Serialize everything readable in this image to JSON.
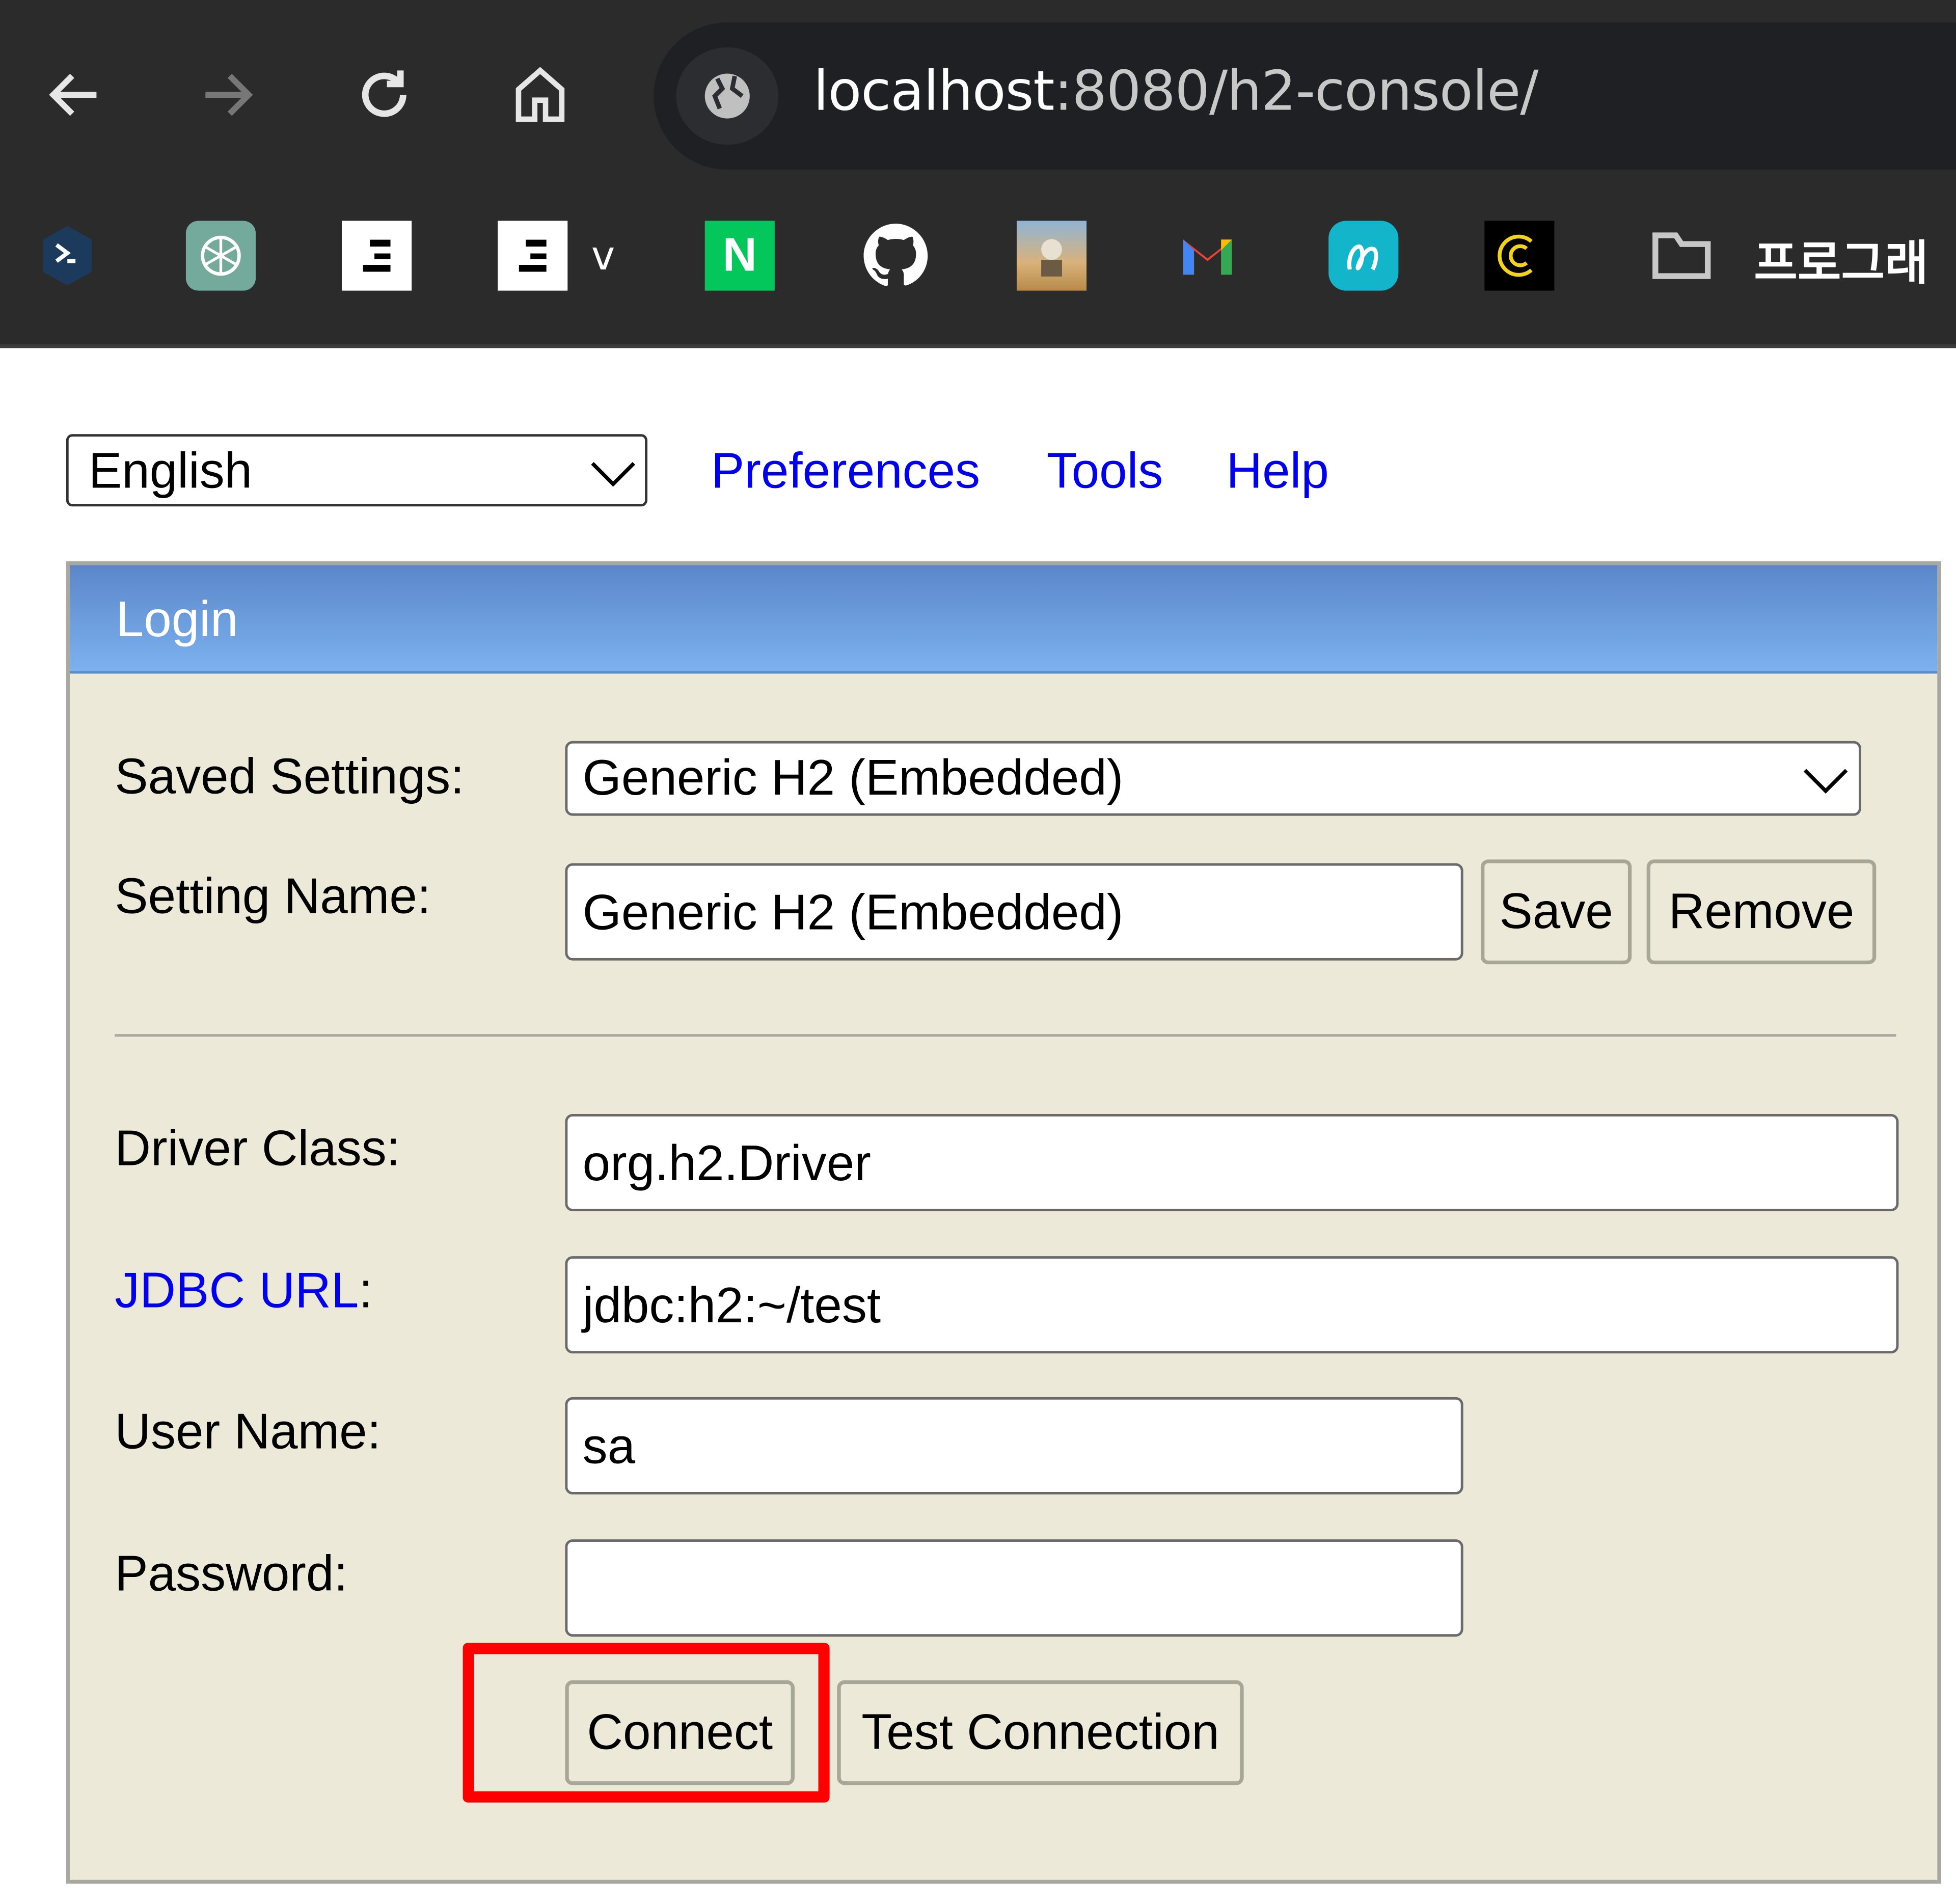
{
  "browser": {
    "url_host": "localhost",
    "url_path": ":8080/h2-console/",
    "bookmarks": [
      {
        "name": "remote-desktop-bookmark",
        "icon": "arrows-icon",
        "color": "#1c3a5c"
      },
      {
        "name": "chatgpt-bookmark",
        "icon": "openai-icon",
        "color": "#74aa9c"
      },
      {
        "name": "notion-bookmark-1",
        "icon": "notion-icon",
        "color": "#ffffff"
      },
      {
        "name": "notion-bookmark-2",
        "icon": "notion-icon",
        "color": "#ffffff",
        "label": "v"
      },
      {
        "name": "naver-bookmark",
        "icon": "naver-icon",
        "color": "#03c75a",
        "label_glyph": "N"
      },
      {
        "name": "github-bookmark",
        "icon": "github-icon",
        "color": "#ffffff"
      },
      {
        "name": "image-bookmark",
        "icon": "photo-icon",
        "color": "#c9a46a"
      },
      {
        "name": "gmail-bookmark",
        "icon": "gmail-icon",
        "color": "#ea4335"
      },
      {
        "name": "swirl-bookmark",
        "icon": "swirl-icon",
        "color": "#12b5c9"
      },
      {
        "name": "c-bookmark",
        "icon": "c-logo-icon",
        "color": "#f2d21b"
      }
    ],
    "bookmark_folder_label": "프로그래"
  },
  "topbar": {
    "language": "English",
    "links": [
      "Preferences",
      "Tools",
      "Help"
    ]
  },
  "login": {
    "title": "Login",
    "saved_settings_label": "Saved Settings:",
    "saved_settings_value": "Generic H2 (Embedded)",
    "setting_name_label": "Setting Name:",
    "setting_name_value": "Generic H2 (Embedded)",
    "save_button": "Save",
    "remove_button": "Remove",
    "driver_class_label": "Driver Class:",
    "driver_class_value": "org.h2.Driver",
    "jdbc_url_label": "JDBC URL",
    "jdbc_url_colon": ":",
    "jdbc_url_value": "jdbc:h2:~/test",
    "user_name_label": "User Name:",
    "user_name_value": "sa",
    "password_label": "Password:",
    "password_value": "",
    "connect_button": "Connect",
    "test_connection_button": "Test Connection",
    "highlight_color": "#ff0000"
  }
}
